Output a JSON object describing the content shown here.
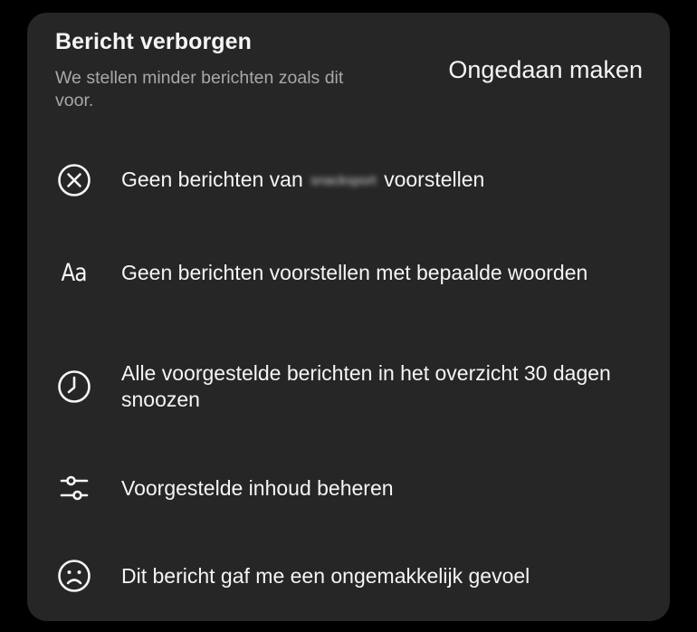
{
  "header": {
    "title": "Bericht verborgen",
    "subtitle": "We stellen minder berichten zoals dit voor.",
    "undo_label": "Ongedaan maken"
  },
  "options": [
    {
      "icon": "close-circle-icon",
      "prefix": "Geen berichten van ",
      "account": "snacksport",
      "suffix": " voorstellen"
    },
    {
      "icon": "text-aa-icon",
      "icon_text": "Aa",
      "label": "Geen berichten voorstellen met bepaalde woorden"
    },
    {
      "icon": "clock-icon",
      "label": "Alle voorgestelde berichten in het overzicht 30 dagen snoozen"
    },
    {
      "icon": "sliders-icon",
      "label": "Voorgestelde inhoud beheren"
    },
    {
      "icon": "sad-face-icon",
      "label": "Dit bericht gaf me een ongemakkelijk gevoel"
    }
  ]
}
